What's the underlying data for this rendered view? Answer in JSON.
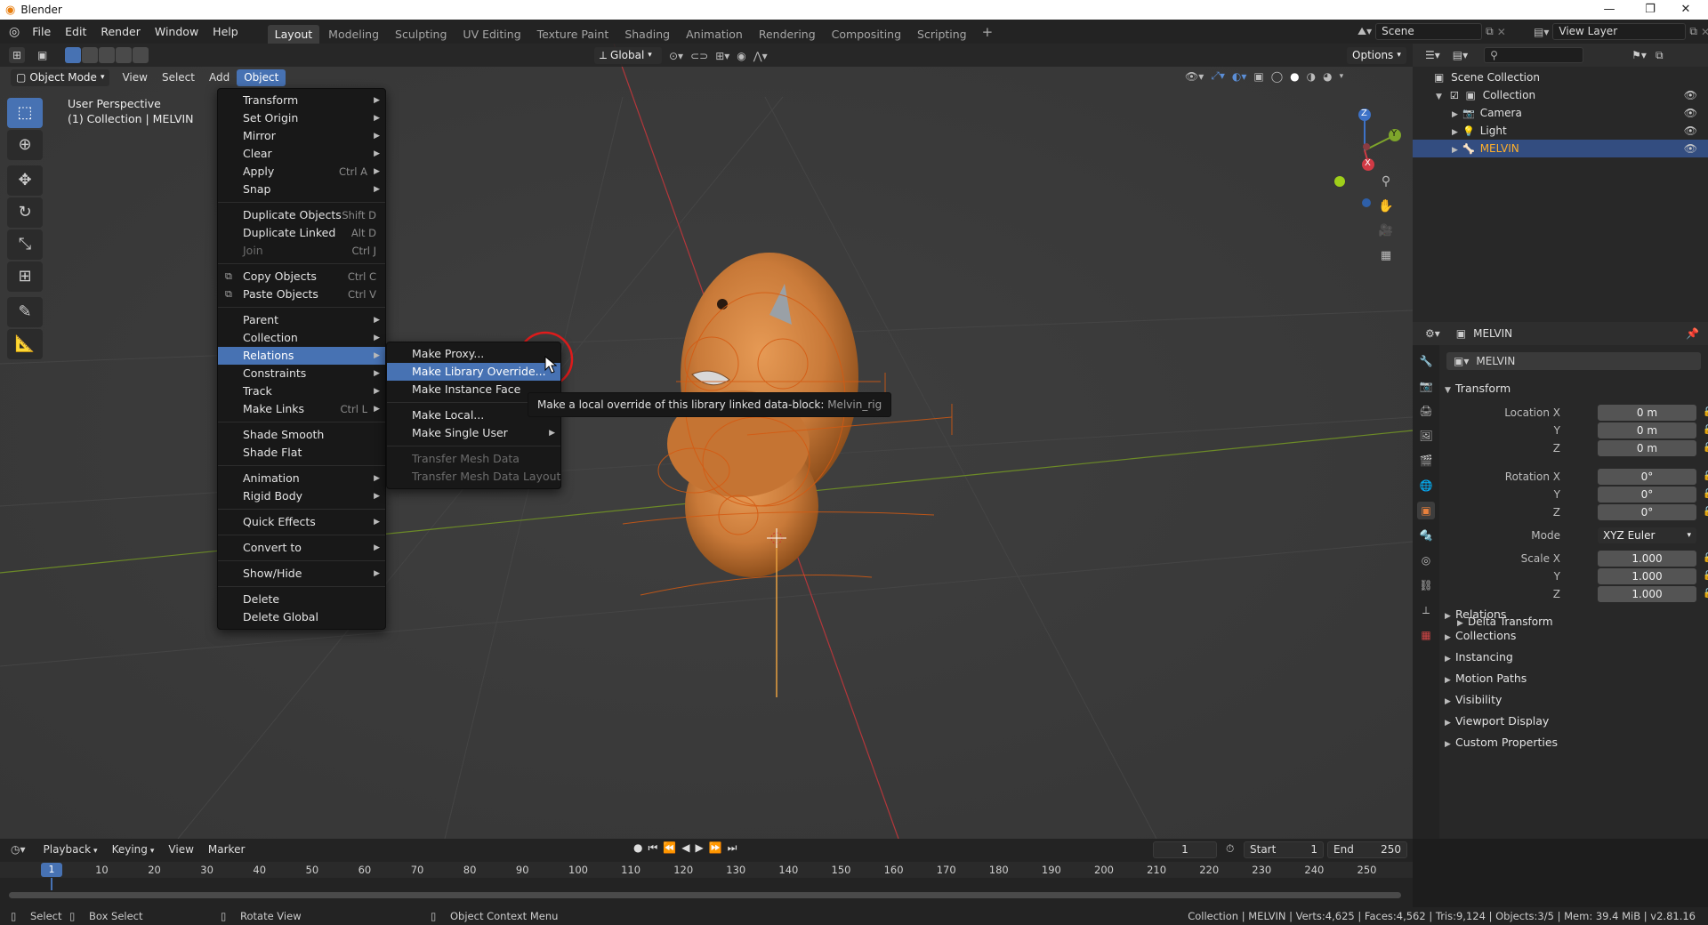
{
  "window": {
    "title": "Blender"
  },
  "menubar": {
    "items": [
      "File",
      "Edit",
      "Render",
      "Window",
      "Help"
    ]
  },
  "workspaces": {
    "active": "Layout",
    "tabs": [
      "Layout",
      "Modeling",
      "Sculpting",
      "UV Editing",
      "Texture Paint",
      "Shading",
      "Animation",
      "Rendering",
      "Compositing",
      "Scripting"
    ]
  },
  "scene": {
    "name": "Scene"
  },
  "view_layer": {
    "name": "View Layer"
  },
  "viewport": {
    "header": {
      "mode": "Object Mode",
      "menus": [
        "View",
        "Select",
        "Add",
        "Object"
      ],
      "active_menu": "Object",
      "orientation": "Global",
      "options": "Options"
    },
    "info": {
      "perspective": "User Perspective",
      "collection_line": "(1) Collection | MELVIN"
    },
    "gizmo_axes": {
      "z": "Z",
      "y": "Y",
      "x": "X"
    }
  },
  "object_menu": {
    "items": [
      {
        "label": "Transform",
        "arrow": true
      },
      {
        "label": "Set Origin",
        "arrow": true
      },
      {
        "label": "Mirror",
        "arrow": true
      },
      {
        "label": "Clear",
        "arrow": true
      },
      {
        "label": "Apply",
        "shortcut": "Ctrl A",
        "arrow": true
      },
      {
        "label": "Snap",
        "arrow": true
      },
      {
        "sep": true
      },
      {
        "label": "Duplicate Objects",
        "shortcut": "Shift D"
      },
      {
        "label": "Duplicate Linked",
        "shortcut": "Alt D"
      },
      {
        "label": "Join",
        "shortcut": "Ctrl J",
        "disabled": true
      },
      {
        "sep": true
      },
      {
        "label": "Copy Objects",
        "shortcut": "Ctrl C",
        "icon": "copy-icon"
      },
      {
        "label": "Paste Objects",
        "shortcut": "Ctrl V",
        "icon": "paste-icon"
      },
      {
        "sep": true
      },
      {
        "label": "Parent",
        "arrow": true
      },
      {
        "label": "Collection",
        "arrow": true
      },
      {
        "label": "Relations",
        "arrow": true,
        "highlight": true
      },
      {
        "label": "Constraints",
        "arrow": true
      },
      {
        "label": "Track",
        "arrow": true
      },
      {
        "label": "Make Links",
        "shortcut": "Ctrl L",
        "arrow": true
      },
      {
        "sep": true
      },
      {
        "label": "Shade Smooth"
      },
      {
        "label": "Shade Flat"
      },
      {
        "sep": true
      },
      {
        "label": "Animation",
        "arrow": true
      },
      {
        "label": "Rigid Body",
        "arrow": true
      },
      {
        "sep": true
      },
      {
        "label": "Quick Effects",
        "arrow": true
      },
      {
        "sep": true
      },
      {
        "label": "Convert to",
        "arrow": true
      },
      {
        "sep": true
      },
      {
        "label": "Show/Hide",
        "arrow": true
      },
      {
        "sep": true
      },
      {
        "label": "Delete"
      },
      {
        "label": "Delete Global"
      }
    ]
  },
  "relations_menu": {
    "items": [
      {
        "label": "Make Proxy..."
      },
      {
        "label": "Make Library Override...",
        "highlight": true
      },
      {
        "label": "Make Instance Face"
      },
      {
        "sep": true
      },
      {
        "label": "Make Local..."
      },
      {
        "label": "Make Single User",
        "arrow": true
      },
      {
        "sep": true
      },
      {
        "label": "Transfer Mesh Data",
        "disabled": true
      },
      {
        "label": "Transfer Mesh Data Layout",
        "disabled": true
      }
    ]
  },
  "tooltip": {
    "text": "Make a local override of this library linked data-block:",
    "target": "Melvin_rig"
  },
  "outliner": {
    "root": "Scene Collection",
    "collection": "Collection",
    "items": [
      {
        "label": "Camera",
        "icon": "camera-icon"
      },
      {
        "label": "Light",
        "icon": "light-icon"
      },
      {
        "label": "MELVIN",
        "icon": "armature-icon",
        "selected": true
      }
    ]
  },
  "properties": {
    "object_name": "MELVIN",
    "datablock": "MELVIN",
    "transform": {
      "title": "Transform",
      "location_label": "Location X",
      "location": [
        "0 m",
        "0 m",
        "0 m"
      ],
      "rotation_label": "Rotation X",
      "rotation": [
        "0°",
        "0°",
        "0°"
      ],
      "mode_label": "Mode",
      "mode": "XYZ Euler",
      "scale_label": "Scale X",
      "scale": [
        "1.000",
        "1.000",
        "1.000"
      ],
      "y": "Y",
      "z": "Z",
      "delta": "Delta Transform"
    },
    "panels": [
      "Relations",
      "Collections",
      "Instancing",
      "Motion Paths",
      "Visibility",
      "Viewport Display",
      "Custom Properties"
    ]
  },
  "timeline": {
    "menus": [
      "Playback",
      "Keying",
      "View",
      "Marker"
    ],
    "current_frame": "1",
    "start_label": "Start",
    "start": "1",
    "end_label": "End",
    "end": "250",
    "ruler": [
      "10",
      "20",
      "30",
      "40",
      "50",
      "60",
      "70",
      "80",
      "90",
      "100",
      "110",
      "120",
      "130",
      "140",
      "150",
      "160",
      "170",
      "180",
      "190",
      "200",
      "210",
      "220",
      "230",
      "240",
      "250"
    ],
    "playhead": "1"
  },
  "statusbar": {
    "select": "Select",
    "box_select": "Box Select",
    "rotate_view": "Rotate View",
    "context_menu": "Object Context Menu",
    "stats": "Collection | MELVIN | Verts:4,625 | Faces:4,562 | Tris:9,124 | Objects:3/5 | Mem: 39.4 MiB | v2.81.16"
  }
}
